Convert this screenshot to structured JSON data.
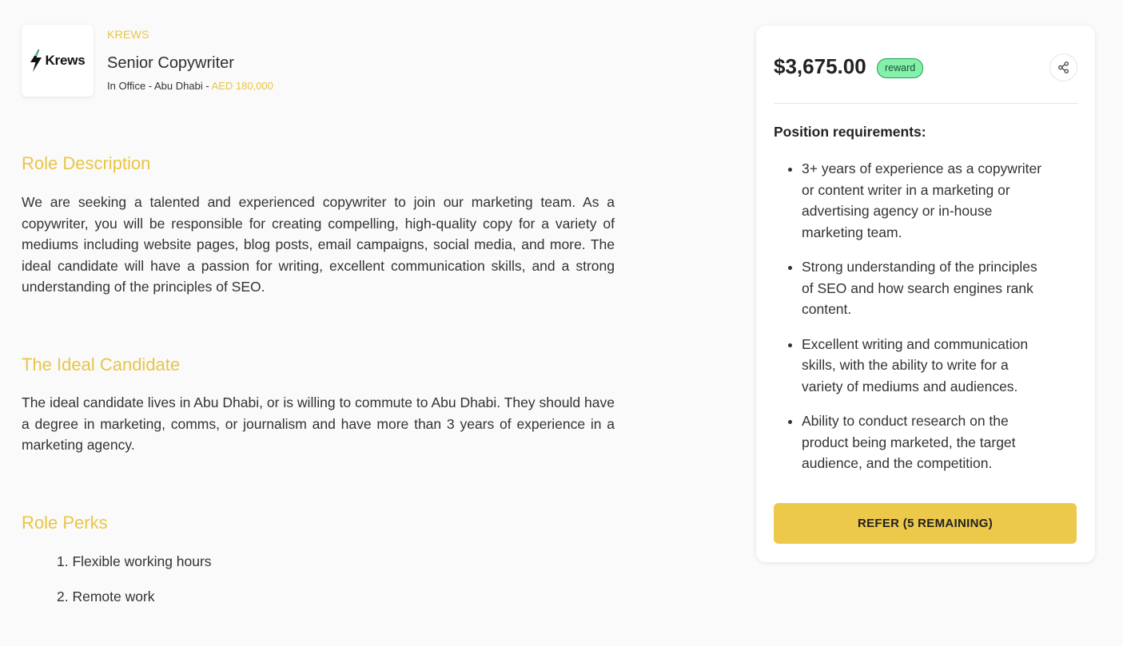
{
  "job": {
    "company": "KREWS",
    "logo_text": "Krews",
    "title": "Senior Copywriter",
    "location": "In Office - Abu Dhabi - ",
    "salary": "AED 180,000"
  },
  "sections": {
    "role_description": {
      "title": "Role Description",
      "body": "We are seeking a talented and experienced copywriter to join our marketing team. As a copywriter, you will be responsible for creating compelling, high-quality copy for a variety of mediums including website pages, blog posts, email campaigns, social media, and more. The ideal candidate will have a passion for writing, excellent communication skills, and a strong understanding of the principles of SEO."
    },
    "ideal_candidate": {
      "title": "The Ideal Candidate",
      "body": "The ideal candidate lives in Abu Dhabi, or is willing to commute to Abu Dhabi. They should have a degree in marketing, comms, or journalism and have more than 3 years of experience in a marketing agency."
    },
    "perks": {
      "title": "Role Perks",
      "items": [
        "1. Flexible working hours",
        "2. Remote work"
      ]
    }
  },
  "card": {
    "amount": "$3,675.00",
    "badge": "reward",
    "requirements_title": "Position requirements:",
    "requirements": [
      "3+ years of experience as a copywriter or content writer in a marketing or advertising agency or in-house marketing team.",
      "Strong understanding of the principles of SEO and how search engines rank content.",
      "Excellent writing and communication skills, with the ability to write for a variety of mediums and audiences.",
      "Ability to conduct research on the product being marketed, the target audience, and the competition."
    ],
    "refer_label": "REFER (5 REMAINING)"
  },
  "icons": {
    "logo": "lightning-bolt-icon",
    "share": "share-icon"
  },
  "colors": {
    "accent": "#e8c547",
    "button": "#ecc94b",
    "badge_bg": "#86efac",
    "badge_border": "#16a34a"
  }
}
